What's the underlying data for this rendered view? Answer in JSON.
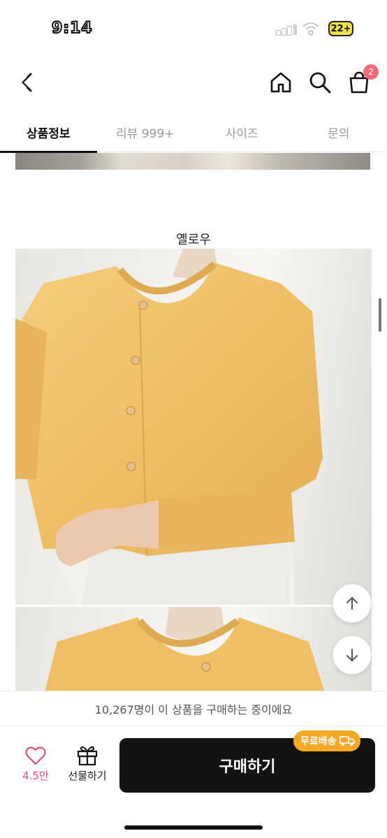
{
  "status_bar": {
    "time": "9:14",
    "battery": "22+"
  },
  "nav": {
    "cart_count": "2"
  },
  "tabs": [
    {
      "label": "상품정보",
      "active": true
    },
    {
      "label": "리뷰 999+",
      "active": false
    },
    {
      "label": "사이즈",
      "active": false
    },
    {
      "label": "문의",
      "active": false
    }
  ],
  "content": {
    "color_label": "옐로우"
  },
  "buyers": {
    "text": "10,267명이 이 상품을 구매하는 중이에요"
  },
  "bottom": {
    "wish_count": "4.5만",
    "gift_label": "선물하기",
    "buy_label": "구매하기",
    "free_shipping_label": "무료배송"
  },
  "colors": {
    "accent": "#f06a7a",
    "wish": "#e8506a",
    "shipping_badge": "#f6a928",
    "buy_button": "#131313",
    "cardigan": "#f0c36a"
  },
  "icons": [
    "back-icon",
    "home-icon",
    "search-icon",
    "cart-icon",
    "arrow-up-icon",
    "arrow-down-icon",
    "heart-icon",
    "gift-icon",
    "truck-icon"
  ]
}
